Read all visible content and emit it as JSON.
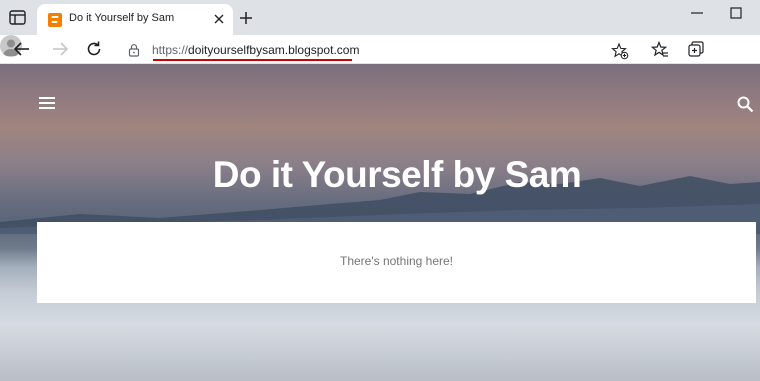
{
  "browser": {
    "tab": {
      "title": "Do it Yourself by Sam",
      "favicon": "blogger-icon"
    },
    "address_bar": {
      "protocol": "https://",
      "host": "doityourselfbysam.blogspot.com"
    }
  },
  "blog": {
    "title": "Do it Yourself by Sam",
    "empty_message": "There's nothing here!"
  },
  "colors": {
    "accent_underline": "#d40000",
    "favicon": "#f57d00"
  }
}
